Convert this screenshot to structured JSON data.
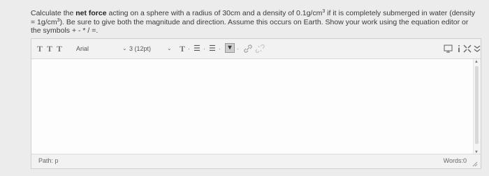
{
  "question": {
    "part1": "Calculate the ",
    "bold": "net force",
    "part2": " acting on a sphere with a radius of 30cm and a density of 0.1g/cm",
    "sup1": "3",
    "part3": " if it is completely submerged in water (density = 1g/cm",
    "sup2": "3",
    "part4": "). Be sure to give both the magnitude and direction. Assume this occurs on Earth. Show your work using the equation editor or the symbols + - * / =."
  },
  "toolbar": {
    "format_glyph": "T",
    "font_family": "Arial",
    "font_size": "3 (12pt)",
    "dropdown_arrow": "⌄",
    "text_color_glyph": "T",
    "bullet_list_glyph": "☰",
    "numbered_list_glyph": "☰",
    "dot": "·",
    "highlight_glyph": "▾"
  },
  "editor": {
    "path_label": "Path: p",
    "word_count": "Words:0"
  },
  "colors": {
    "page_bg": "#ececec",
    "editor_bg": "#fdfdfd",
    "toolbar_bg": "#f2f2f2"
  }
}
